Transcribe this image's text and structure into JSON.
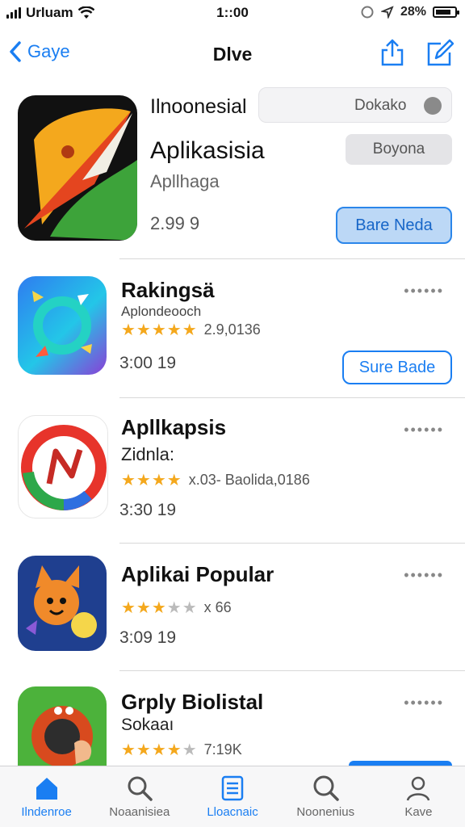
{
  "status_bar": {
    "carrier": "Urluam",
    "time": "1::00",
    "battery_percent": "28%"
  },
  "nav": {
    "back_label": "Gaye",
    "title": "Dlve"
  },
  "featured": {
    "title": "Ilnoonesial",
    "search_text": "Dokako",
    "name": "Aplikasisia",
    "subtitle": "Apllhaga",
    "meta": "2.99 9",
    "secondary_button": "Boyona",
    "primary_button": "Bare Neda"
  },
  "apps": [
    {
      "name": "Rakingsä",
      "subtitle": "Aplondeooch",
      "rating_value": 4.5,
      "rating_text": "2.9,0136",
      "meta": "3:00 19",
      "button": "Sure Bade",
      "more": "••••••"
    },
    {
      "name": "Apllkapsis",
      "subtitle": "Zidnla:",
      "rating_value": 4,
      "rating_text": "x.03- Baolida,0186",
      "meta": "3:30 19",
      "more": "••••••"
    },
    {
      "name": "Aplikai Popular",
      "subtitle": "",
      "rating_value": 3,
      "rating_text": "x 66",
      "meta": "3:09 19",
      "more": "••••••"
    },
    {
      "name": "Grply Biolistal",
      "subtitle": "Sokaaı",
      "rating_value": 4.5,
      "rating_text": "7:19K",
      "meta": "",
      "more": "••••••"
    }
  ],
  "tabs": [
    {
      "label": "Ilndenroe",
      "icon": "home-icon",
      "active": true
    },
    {
      "label": "Noaanisiea",
      "icon": "search-icon",
      "active": false
    },
    {
      "label": "Lloacnaic",
      "icon": "list-icon",
      "active": false
    },
    {
      "label": "Noonenius",
      "icon": "search-icon",
      "active": false
    },
    {
      "label": "Kave",
      "icon": "person-icon",
      "active": false
    }
  ],
  "colors": {
    "accent": "#1a7ef2",
    "star": "#f4a81d",
    "divider": "#d8d8d8"
  }
}
